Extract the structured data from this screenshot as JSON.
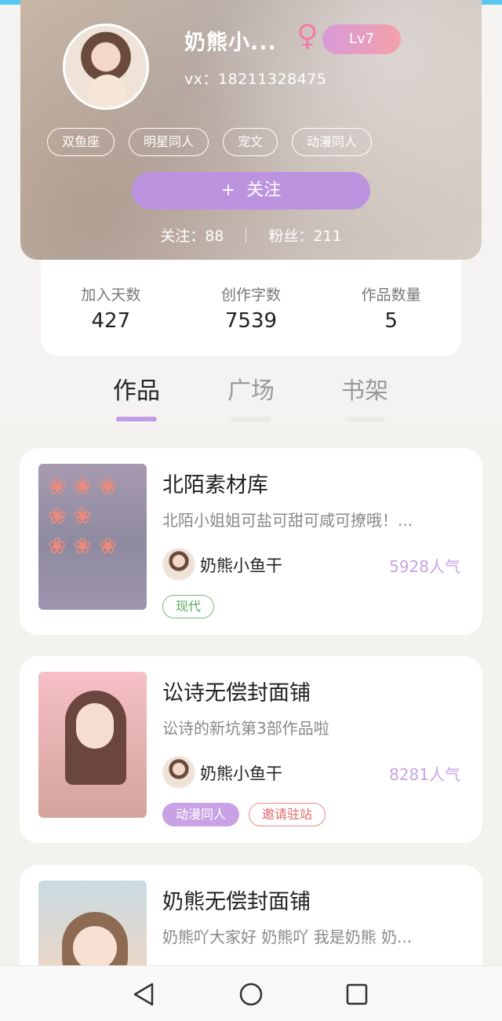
{
  "profile": {
    "username": "奶熊小...",
    "gender_icon": "female-symbol",
    "level": "Lv7",
    "vx": "vx：18211328475",
    "tags": [
      "双鱼座",
      "明星同人",
      "宠文",
      "动漫同人"
    ],
    "follow_button": "关注",
    "follow_plus": "+",
    "following": "关注：88",
    "fans": "粉丝：211"
  },
  "stats": [
    {
      "label": "加入天数",
      "value": "427"
    },
    {
      "label": "创作字数",
      "value": "7539"
    },
    {
      "label": "作品数量",
      "value": "5"
    }
  ],
  "tabs": [
    "作品",
    "广场",
    "书架"
  ],
  "active_tab": "作品",
  "works": [
    {
      "title": "北陌素材库",
      "desc": "北陌小姐姐可盐可甜可咸可撩哦！...",
      "author": "奶熊小鱼干",
      "popularity": "5928人气",
      "tags": [
        {
          "label": "现代",
          "style": "green"
        }
      ]
    },
    {
      "title": "讼诗无偿封面铺",
      "desc": "讼诗的新坑第3部作品啦",
      "author": "奶熊小鱼干",
      "popularity": "8281人气",
      "tags": [
        {
          "label": "动漫同人",
          "style": "purple"
        },
        {
          "label": "邀请驻站",
          "style": "red"
        }
      ]
    },
    {
      "title": "奶熊无偿封面铺",
      "desc": "奶熊吖大家好 奶熊吖 我是奶熊 奶...",
      "author": "",
      "popularity": "",
      "tags": []
    }
  ],
  "colors": {
    "accent_purple": "#bb93df",
    "popularity": "#c7a4e2",
    "gender_pink": "#f07fa5",
    "top_strip": "#5ac8f0"
  },
  "navbar": {
    "icons": [
      "back-triangle-icon",
      "home-circle-icon",
      "recent-square-icon"
    ]
  }
}
